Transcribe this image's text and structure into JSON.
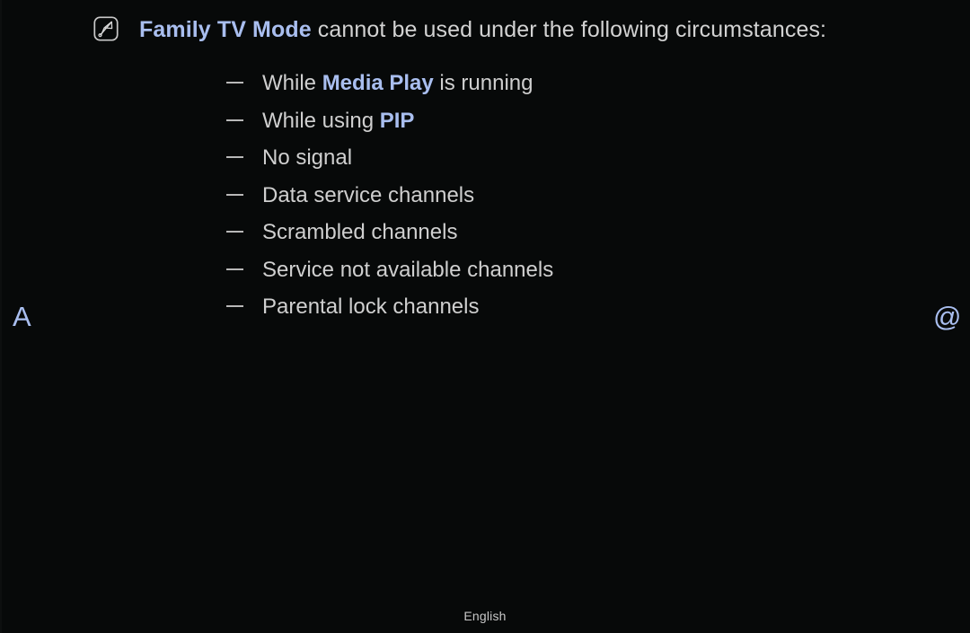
{
  "screen": {
    "background_color": "#070909",
    "text_color": "#cfcfcf",
    "accent_color": "#a9beef"
  },
  "note": {
    "icon_name": "note-pencil-icon",
    "title": {
      "highlight": "Family TV Mode",
      "rest": " cannot be used under the following circumstances:"
    },
    "items": [
      {
        "prefix": "While ",
        "highlight": "Media Play",
        "suffix": " is running"
      },
      {
        "prefix": "While using ",
        "highlight": "PIP",
        "suffix": ""
      },
      {
        "prefix": "No signal",
        "highlight": "",
        "suffix": ""
      },
      {
        "prefix": "Data service channels",
        "highlight": "",
        "suffix": ""
      },
      {
        "prefix": "Scrambled channels",
        "highlight": "",
        "suffix": ""
      },
      {
        "prefix": "Service not available channels",
        "highlight": "",
        "suffix": ""
      },
      {
        "prefix": "Parental lock channels",
        "highlight": "",
        "suffix": ""
      }
    ]
  },
  "keys": {
    "left": {
      "label": "A",
      "icon_name": "red-color-key-a"
    },
    "right": {
      "label": "@",
      "icon_name": "at-symbol-key"
    }
  },
  "footer": {
    "language": "English"
  }
}
